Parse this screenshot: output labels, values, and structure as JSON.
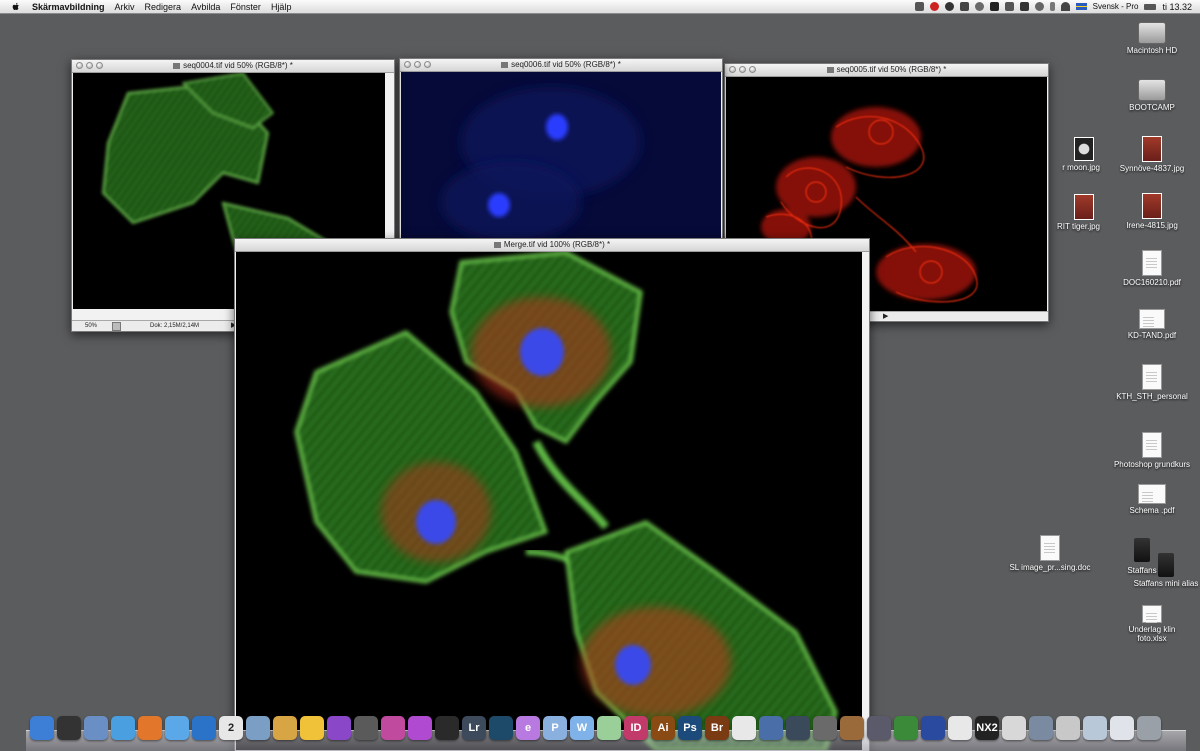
{
  "menubar": {
    "app_name": "Skärmavbildning",
    "items": [
      "Arkiv",
      "Redigera",
      "Avbilda",
      "Fönster",
      "Hjälp"
    ],
    "input_source": "Svensk - Pro",
    "clock": "ti 13.32"
  },
  "windows": {
    "green": {
      "title": "seq0004.tif vid 50% (RGB/8*) *",
      "zoom": "50%",
      "doc_size": "Dok: 2,15M/2,14M"
    },
    "blue": {
      "title": "seq0006.tif vid 50% (RGB/8*) *"
    },
    "red": {
      "title": "seq0005.tif vid 50% (RGB/8*) *"
    },
    "merge": {
      "title": "Merge.tif vid 100% (RGB/8*) *"
    }
  },
  "desktop": {
    "icons": [
      {
        "label": "Macintosh HD",
        "icon": "hard-drive-icon"
      },
      {
        "label": "BOOTCAMP",
        "icon": "hard-drive-icon"
      },
      {
        "label": "Synnöve-4837.jpg",
        "icon": "photo-icon"
      },
      {
        "label": "Irene-4815.jpg",
        "icon": "photo-icon"
      },
      {
        "label": "DOC160210.pdf",
        "icon": "pdf-icon"
      },
      {
        "label": "KD-TAND.pdf",
        "icon": "pdf-icon"
      },
      {
        "label": "KTH_STH_personal",
        "icon": "document-icon"
      },
      {
        "label": "Photoshop grundkurs",
        "icon": "document-icon"
      },
      {
        "label": "Schema .pdf",
        "icon": "pdf-icon"
      },
      {
        "label": "Staffans",
        "icon": "drive-icon"
      },
      {
        "label": "Staffans mini alias",
        "icon": "alias-icon"
      },
      {
        "label": "Underlag klin foto.xlsx",
        "icon": "spreadsheet-icon"
      },
      {
        "label": "SL image_pr...sing.doc",
        "icon": "doc-icon"
      },
      {
        "label": "r moon.jpg",
        "icon": "photo-icon"
      },
      {
        "label": "RIT tiger.jpg",
        "icon": "photo-icon"
      }
    ]
  },
  "dock": {
    "items": [
      {
        "name": "Finder",
        "label": "",
        "color": "#3d7fd6"
      },
      {
        "name": "Dashboard",
        "label": "",
        "color": "#333333"
      },
      {
        "name": "Mail",
        "label": "",
        "color": "#6a8fc4"
      },
      {
        "name": "iTunes",
        "label": "",
        "color": "#4a9fe0"
      },
      {
        "name": "Firefox",
        "label": "",
        "color": "#e2762a"
      },
      {
        "name": "Safari",
        "label": "",
        "color": "#5aa8e8"
      },
      {
        "name": "QuickTime",
        "label": "",
        "color": "#2b73c8"
      },
      {
        "name": "iCal",
        "label": "2",
        "color": "#e7e7e7"
      },
      {
        "name": "Preview",
        "label": "",
        "color": "#7a9ec4"
      },
      {
        "name": "iPhoto",
        "label": "",
        "color": "#d8a545"
      },
      {
        "name": "Paste",
        "label": "",
        "color": "#f0c23a"
      },
      {
        "name": "Media",
        "label": "",
        "color": "#8a48c8"
      },
      {
        "name": "Disk",
        "label": "",
        "color": "#5a5a5a"
      },
      {
        "name": "Colors",
        "label": "",
        "color": "#c04a9e"
      },
      {
        "name": "iMovie",
        "label": "",
        "color": "#b04ad0"
      },
      {
        "name": "Clapper",
        "label": "",
        "color": "#2a2a2a"
      },
      {
        "name": "Lightroom",
        "label": "Lr",
        "color": "#3c4a5c"
      },
      {
        "name": "Capture",
        "label": "",
        "color": "#1e4a6a"
      },
      {
        "name": "Edge",
        "label": "e",
        "color": "#b87ae0"
      },
      {
        "name": "Web",
        "label": "P",
        "color": "#8ab0e0"
      },
      {
        "name": "Word",
        "label": "W",
        "color": "#7fb2e8"
      },
      {
        "name": "Excel",
        "label": "",
        "color": "#9acf9a"
      },
      {
        "name": "InDesign",
        "label": "ID",
        "color": "#c23a6a"
      },
      {
        "name": "Illustrator",
        "label": "Ai",
        "color": "#8a4a14"
      },
      {
        "name": "Photoshop",
        "label": "Ps",
        "color": "#1c4a7a"
      },
      {
        "name": "Bridge",
        "label": "Br",
        "color": "#7a3a12"
      },
      {
        "name": "Acrobat",
        "label": "",
        "color": "#e8e8e8"
      },
      {
        "name": "Spaces",
        "label": "",
        "color": "#4a6ea8"
      },
      {
        "name": "Time Machine",
        "label": "",
        "color": "#3a4a5a"
      },
      {
        "name": "Utilities",
        "label": "",
        "color": "#6a6a6a"
      },
      {
        "name": "Presentation",
        "label": "",
        "color": "#9a6a3a"
      },
      {
        "name": "Script",
        "label": "",
        "color": "#5a5a6a"
      },
      {
        "name": "Office",
        "label": "",
        "color": "#3a8a3a"
      },
      {
        "name": "Remote",
        "label": "",
        "color": "#2a4aa0"
      },
      {
        "name": "Cisco",
        "label": "",
        "color": "#e8e8e8"
      },
      {
        "name": "NX2",
        "label": "NX2",
        "color": "#222222"
      },
      {
        "name": "Tools",
        "label": "",
        "color": "#d8d8d8"
      },
      {
        "name": "Downloads",
        "label": "",
        "color": "#7a8aa0"
      },
      {
        "name": "USB",
        "label": "",
        "color": "#c8c8c8"
      },
      {
        "name": "Documents",
        "label": "",
        "color": "#b8c8d8"
      },
      {
        "name": "Stack",
        "label": "",
        "color": "#e0e4ea"
      },
      {
        "name": "Trash",
        "label": "",
        "color": "#9aa0a8"
      }
    ]
  }
}
